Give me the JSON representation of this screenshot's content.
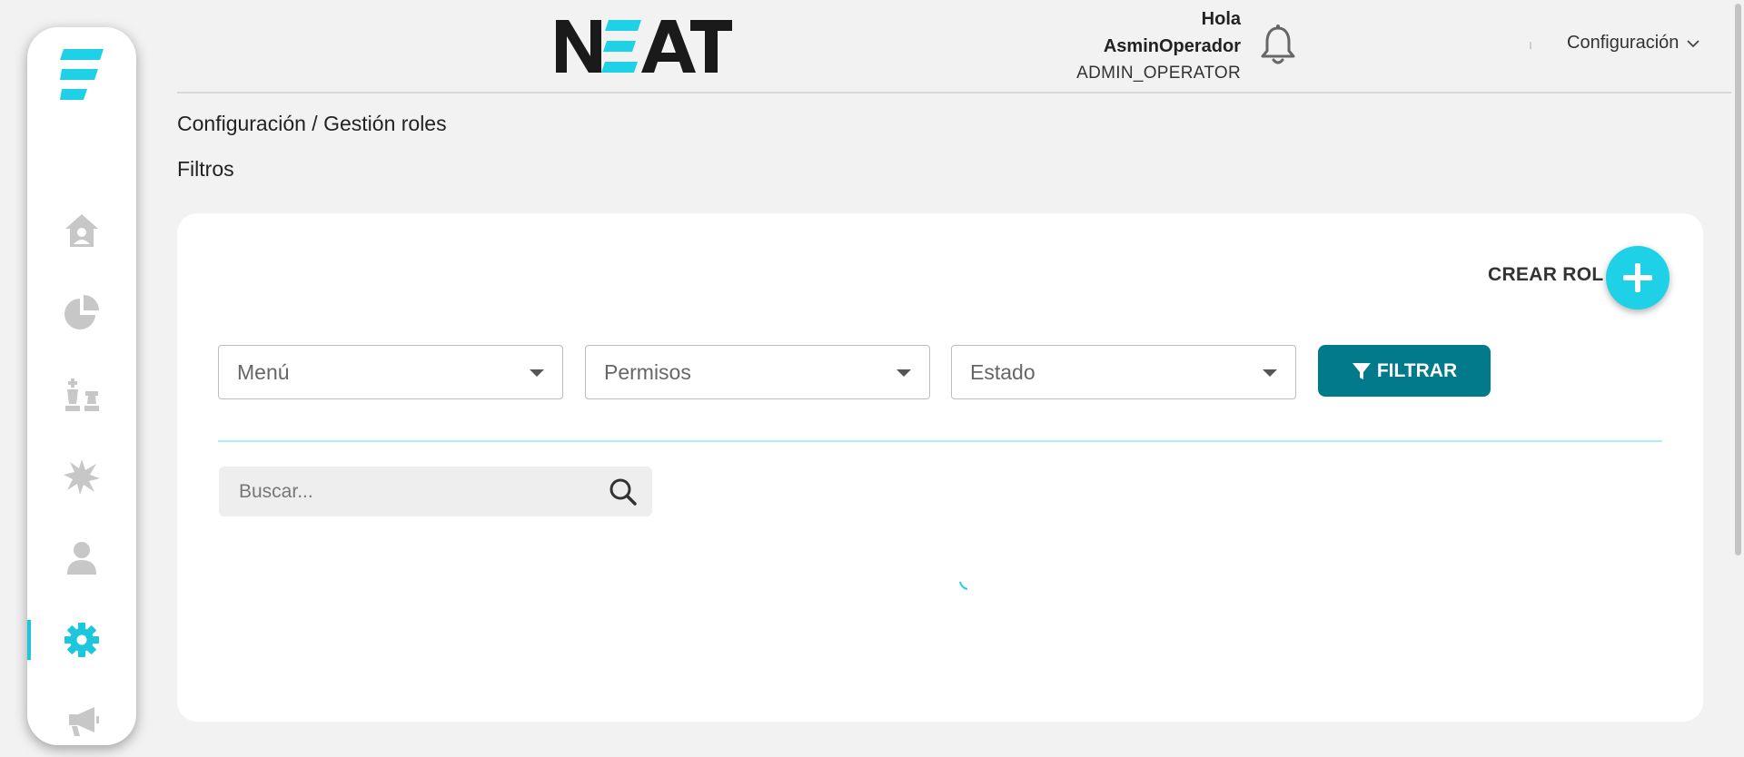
{
  "sidebar": {
    "items": [
      {
        "name": "home",
        "icon": "home-user-icon",
        "active": false
      },
      {
        "name": "dashboard",
        "icon": "pie-chart-icon",
        "active": false
      },
      {
        "name": "strategy",
        "icon": "chess-icon",
        "active": false
      },
      {
        "name": "incidents",
        "icon": "burst-icon",
        "active": false
      },
      {
        "name": "users",
        "icon": "user-icon",
        "active": false
      },
      {
        "name": "settings",
        "icon": "gear-icon",
        "active": true
      },
      {
        "name": "campaigns",
        "icon": "megaphone-icon",
        "active": false
      }
    ]
  },
  "header": {
    "brand": "NEAT",
    "greeting": "Hola",
    "user_name": "AsminOperador",
    "user_role": "ADMIN_OPERATOR",
    "config_menu": "Configuración"
  },
  "breadcrumb": "Configuración / Gestión roles",
  "filters_title": "Filtros",
  "card": {
    "create_label": "CREAR ROL",
    "selects": [
      {
        "placeholder": "Menú"
      },
      {
        "placeholder": "Permisos"
      },
      {
        "placeholder": "Estado"
      }
    ],
    "filter_button": "FILTRAR",
    "search_placeholder": "Buscar..."
  },
  "colors": {
    "accent": "#1ed1e6",
    "primary_dark": "#027a8b",
    "icon_gray": "#c7c7c7",
    "background": "#f2f2f2"
  }
}
